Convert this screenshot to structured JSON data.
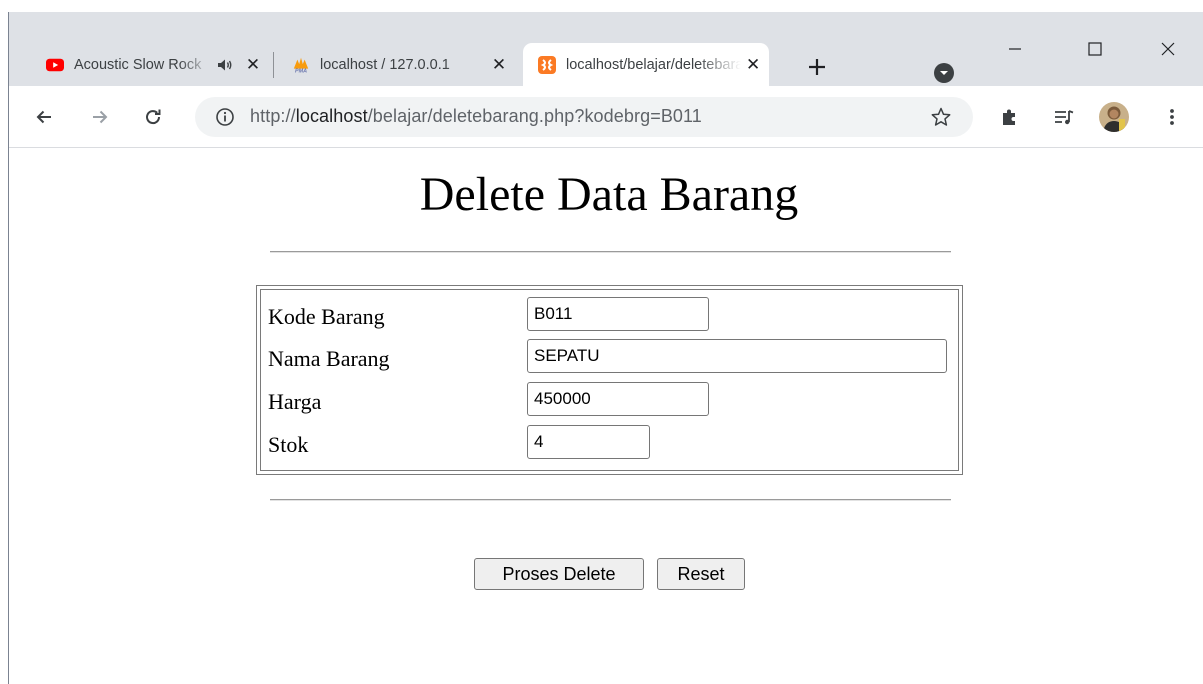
{
  "browser": {
    "tabs": [
      {
        "title": "Acoustic Slow Rock",
        "favicon": "youtube-icon",
        "audio": true,
        "active": false
      },
      {
        "title": "localhost / 127.0.0.1",
        "favicon": "phpmyadmin-icon",
        "active": false
      },
      {
        "title": "localhost/belajar/deletebarang.php",
        "favicon": "xampp-icon",
        "active": true
      }
    ],
    "url": {
      "scheme": "http://",
      "host": "localhost",
      "path": "/belajar/deletebarang.php?kodebrg=B011"
    }
  },
  "page": {
    "title": "Delete Data Barang",
    "fields": [
      {
        "label": "Kode Barang",
        "value": "B011"
      },
      {
        "label": "Nama Barang",
        "value": "SEPATU"
      },
      {
        "label": "Harga",
        "value": "450000"
      },
      {
        "label": "Stok",
        "value": "4"
      }
    ],
    "buttons": {
      "submit": "Proses Delete",
      "reset": "Reset"
    }
  },
  "colors": {
    "tabstrip": "#dee1e6",
    "youtube_red": "#ff0000",
    "xampp_orange": "#fb7a24",
    "omnibox": "#f1f3f4"
  }
}
